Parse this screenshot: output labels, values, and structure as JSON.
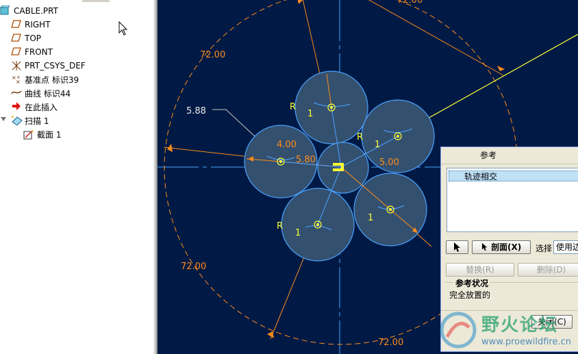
{
  "model_tree": {
    "items": [
      {
        "label": "CABLE.PRT",
        "icon": "part-icon"
      },
      {
        "label": "RIGHT",
        "icon": "datum-plane-icon"
      },
      {
        "label": "TOP",
        "icon": "datum-plane-icon"
      },
      {
        "label": "FRONT",
        "icon": "datum-plane-icon"
      },
      {
        "label": "PRT_CSYS_DEF",
        "icon": "csys-icon"
      },
      {
        "label": "基准点 标识39",
        "icon": "datum-point-icon"
      },
      {
        "label": "曲线 标识44",
        "icon": "curve-icon"
      },
      {
        "label": "在此插入",
        "icon": "insert-here-arrow-icon"
      },
      {
        "label": "扫描 1",
        "icon": "sweep-icon"
      },
      {
        "label": "截面 1",
        "icon": "section-icon"
      }
    ]
  },
  "sketch": {
    "dimensions": {
      "angle_top_right": "72.00",
      "angle_top_left": "72.00",
      "angle_bottom_left": "72.00",
      "angle_bottom": "72.00",
      "offset": "5.88",
      "dia_left": "4.00",
      "dia_center": "5.80",
      "dia_right": "5.00"
    },
    "constraint_labels": {
      "r1": "R",
      "r2": "R",
      "r3": "R",
      "e1": "1",
      "e2": "1",
      "e3": "1",
      "e4": "1"
    },
    "colors": {
      "background": "#001a45",
      "circle_fill": "#34506f",
      "circle_stroke": "#4aa3ff",
      "dimension": "#ff8c1a",
      "trajectory": "#ffff33"
    }
  },
  "reference_dialog": {
    "title": "参考",
    "list_items": [
      "轨迹相交"
    ],
    "section_button": "剖面(X)",
    "select_label": "选择",
    "select_value": "使用边",
    "replace_button": "替换(R)",
    "delete_button": "删除(D)",
    "status_title": "参考状况",
    "status_text": "完全放置的",
    "close_button": "关闭(C)"
  },
  "watermark": {
    "cn": "野火论坛",
    "url": "www.proewildfire.cn"
  }
}
